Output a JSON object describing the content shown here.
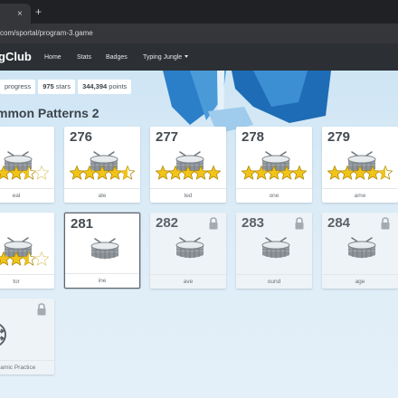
{
  "browser": {
    "tab_close": "×",
    "tab_new": "+",
    "url": "com/sportal/program-3.game"
  },
  "site": {
    "logo": "gClub",
    "nav": [
      {
        "label": "Home"
      },
      {
        "label": "Stats"
      },
      {
        "label": "Badges"
      },
      {
        "label": "Typing Jungle"
      }
    ]
  },
  "progress": {
    "label": "progress",
    "stars_value": "975",
    "stars_unit": "stars",
    "points_value": "344,394",
    "points_unit": "points"
  },
  "section": {
    "title": "mmon Patterns 2"
  },
  "lessons_row1": [
    {
      "num": "75",
      "foot": "eal",
      "stars": 3.5
    },
    {
      "num": "276",
      "foot": "ate",
      "stars": 4.5
    },
    {
      "num": "277",
      "foot": "ted",
      "stars": 5
    },
    {
      "num": "278",
      "foot": "one",
      "stars": 5
    },
    {
      "num": "279",
      "foot": "ame",
      "stars": 4.5
    }
  ],
  "lessons_row2": [
    {
      "num": "80",
      "foot": "tor",
      "stars": 3.5
    },
    {
      "num": "281",
      "foot": "ine",
      "stars": 0,
      "selected": true
    },
    {
      "num": "282",
      "foot": "ave",
      "locked": true
    },
    {
      "num": "283",
      "foot": "ound",
      "locked": true
    },
    {
      "num": "284",
      "foot": "age",
      "locked": true
    }
  ],
  "lessons_row3": [
    {
      "num": "85",
      "foot": "namic Practice",
      "locked": true
    }
  ],
  "colors": {
    "star": "#f2c418",
    "star_outline": "#b28a08",
    "drum_body": "#8c9399",
    "accent_ice": "#1f78c6"
  },
  "icons": {
    "drum": "drum-icon",
    "star": "star-icon",
    "lock": "lock-icon",
    "practice": "shuffle-list-icon"
  }
}
